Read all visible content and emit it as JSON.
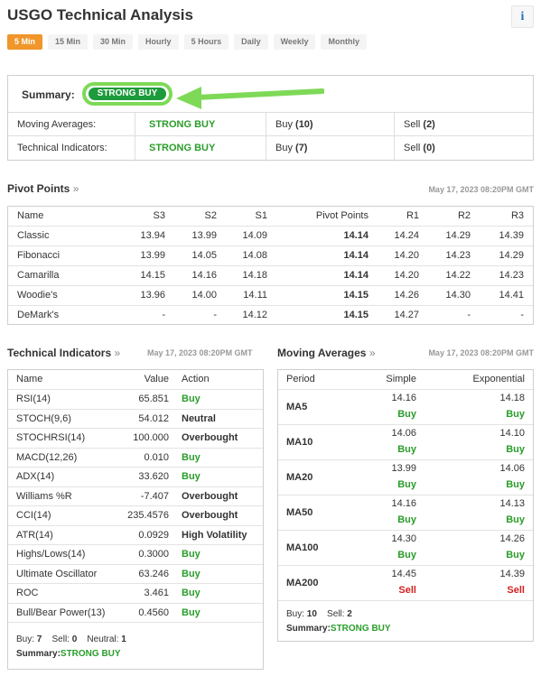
{
  "title": "USGO Technical Analysis",
  "info_icon": "i",
  "tabs": [
    "5 Min",
    "15 Min",
    "30 Min",
    "Hourly",
    "5 Hours",
    "Daily",
    "Weekly",
    "Monthly"
  ],
  "summary": {
    "label": "Summary:",
    "value": "STRONG BUY",
    "rows": [
      {
        "label": "Moving Averages:",
        "signal": "STRONG BUY",
        "buy_label": "Buy",
        "buy": "(10)",
        "sell_label": "Sell",
        "sell": "(2)"
      },
      {
        "label": "Technical Indicators:",
        "signal": "STRONG BUY",
        "buy_label": "Buy",
        "buy": "(7)",
        "sell_label": "Sell",
        "sell": "(0)"
      }
    ]
  },
  "pivot": {
    "title": "Pivot Points",
    "raquo": "»",
    "timestamp": "May 17, 2023 08:20PM GMT",
    "headers": [
      "Name",
      "S3",
      "S2",
      "S1",
      "Pivot Points",
      "R1",
      "R2",
      "R3"
    ],
    "rows": [
      [
        "Classic",
        "13.94",
        "13.99",
        "14.09",
        "14.14",
        "14.24",
        "14.29",
        "14.39"
      ],
      [
        "Fibonacci",
        "13.99",
        "14.05",
        "14.08",
        "14.14",
        "14.20",
        "14.23",
        "14.29"
      ],
      [
        "Camarilla",
        "14.15",
        "14.16",
        "14.18",
        "14.14",
        "14.20",
        "14.22",
        "14.23"
      ],
      [
        "Woodie's",
        "13.96",
        "14.00",
        "14.11",
        "14.15",
        "14.26",
        "14.30",
        "14.41"
      ],
      [
        "DeMark's",
        "-",
        "-",
        "14.12",
        "14.15",
        "14.27",
        "-",
        "-"
      ]
    ]
  },
  "technical": {
    "title": "Technical Indicators",
    "raquo": "»",
    "timestamp": "May 17, 2023 08:20PM GMT",
    "headers": [
      "Name",
      "Value",
      "Action"
    ],
    "rows": [
      [
        "RSI(14)",
        "65.851",
        "Buy"
      ],
      [
        "STOCH(9,6)",
        "54.012",
        "Neutral"
      ],
      [
        "STOCHRSI(14)",
        "100.000",
        "Overbought"
      ],
      [
        "MACD(12,26)",
        "0.010",
        "Buy"
      ],
      [
        "ADX(14)",
        "33.620",
        "Buy"
      ],
      [
        "Williams %R",
        "-7.407",
        "Overbought"
      ],
      [
        "CCI(14)",
        "235.4576",
        "Overbought"
      ],
      [
        "ATR(14)",
        "0.0929",
        "High Volatility"
      ],
      [
        "Highs/Lows(14)",
        "0.3000",
        "Buy"
      ],
      [
        "Ultimate Oscillator",
        "63.246",
        "Buy"
      ],
      [
        "ROC",
        "3.461",
        "Buy"
      ],
      [
        "Bull/Bear Power(13)",
        "0.4560",
        "Buy"
      ]
    ],
    "footer": {
      "buy_label": "Buy:",
      "buy": "7",
      "sell_label": "Sell:",
      "sell": "0",
      "neutral_label": "Neutral:",
      "neutral": "1",
      "summary_label": "Summary:",
      "summary": "STRONG BUY"
    }
  },
  "moving": {
    "title": "Moving Averages",
    "raquo": "»",
    "timestamp": "May 17, 2023 08:20PM GMT",
    "headers": [
      "Period",
      "Simple",
      "Exponential"
    ],
    "rows": [
      [
        "MA5",
        "14.16",
        "Buy",
        "14.18",
        "Buy"
      ],
      [
        "MA10",
        "14.06",
        "Buy",
        "14.10",
        "Buy"
      ],
      [
        "MA20",
        "13.99",
        "Buy",
        "14.06",
        "Buy"
      ],
      [
        "MA50",
        "14.16",
        "Buy",
        "14.13",
        "Buy"
      ],
      [
        "MA100",
        "14.30",
        "Buy",
        "14.26",
        "Buy"
      ],
      [
        "MA200",
        "14.45",
        "Sell",
        "14.39",
        "Sell"
      ]
    ],
    "footer": {
      "buy_label": "Buy:",
      "buy": "10",
      "sell_label": "Sell:",
      "sell": "2",
      "summary_label": "Summary:",
      "summary": "STRONG BUY"
    }
  },
  "colors": {
    "accent": "#f0962a",
    "buy": "#2a9d2a",
    "sell": "#d32020",
    "highlight": "#7ed957"
  }
}
